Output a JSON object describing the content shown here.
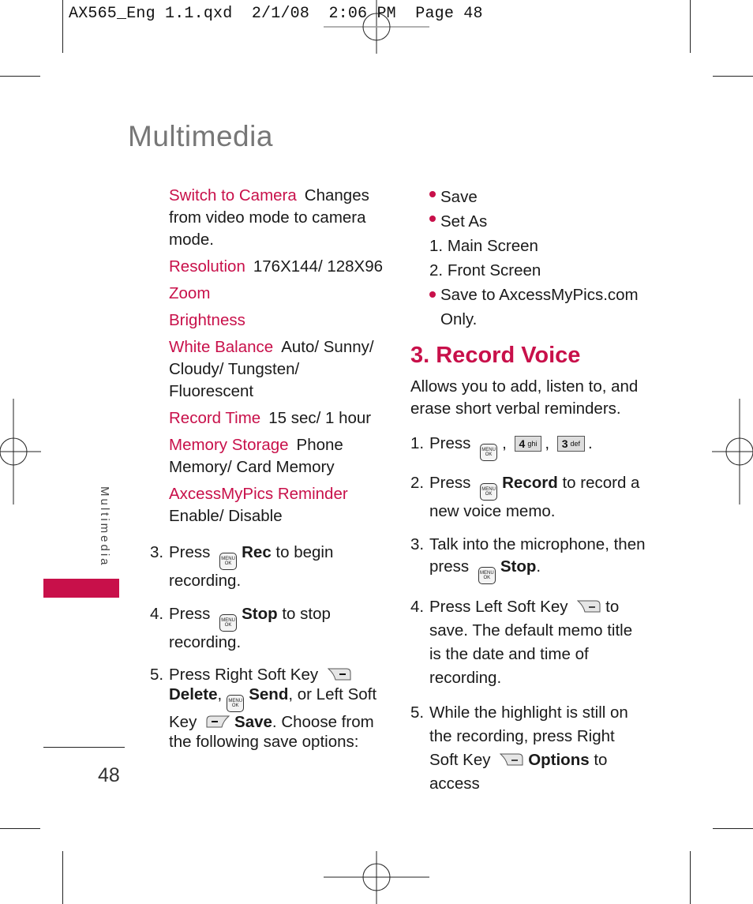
{
  "slug": "AX565_Eng 1.1.qxd  2/1/08  2:06 PM  Page 48",
  "colors": {
    "accent": "#c8104a",
    "title_gray": "#777777"
  },
  "page": {
    "title": "Multimedia",
    "side_tab_label": "Multimedia",
    "page_number": "48"
  },
  "left_column": {
    "options": [
      {
        "term": "Switch to Camera",
        "desc": "Changes from video mode to camera mode."
      },
      {
        "term": "Resolution",
        "desc": "176X144/ 128X96"
      },
      {
        "term": "Zoom",
        "desc": ""
      },
      {
        "term": "Brightness",
        "desc": ""
      },
      {
        "term": "White Balance",
        "desc": "Auto/ Sunny/ Cloudy/ Tungsten/ Fluorescent"
      },
      {
        "term": "Record Time",
        "desc": "15 sec/ 1 hour"
      },
      {
        "term": "Memory Storage",
        "desc": "Phone Memory/ Card Memory"
      },
      {
        "term": "AxcessMyPics Reminder",
        "desc": "Enable/ Disable"
      }
    ],
    "steps": [
      {
        "num": "3.",
        "pre": "Press",
        "key": "menu-ok-key",
        "bold": "Rec",
        "post": "to begin recording."
      },
      {
        "num": "4.",
        "pre": "Press",
        "key": "menu-ok-key",
        "bold": "Stop",
        "post": "to stop recording."
      },
      {
        "num": "5.",
        "pre": "Press Right Soft Key",
        "bold1": "Delete",
        "mid1": ",",
        "bold2": "Send",
        "mid2": ", or Left Soft Key",
        "bold3": "Save",
        "post": ". Choose from the following save options:"
      }
    ]
  },
  "right_column": {
    "save_options": [
      {
        "type": "bullet",
        "label": "Save"
      },
      {
        "type": "bullet",
        "label": "Set As"
      },
      {
        "type": "numbered",
        "num": "1.",
        "label": "Main Screen"
      },
      {
        "type": "numbered",
        "num": "2.",
        "label": "Front Screen"
      },
      {
        "type": "bullet",
        "label": "Save to AxcessMyPics.com Only."
      }
    ],
    "section_title": "3. Record Voice",
    "intro": "Allows you to add, listen to, and erase short verbal reminders.",
    "steps": [
      {
        "num": "1.",
        "pre": "Press",
        "key1": {
          "digit": "4",
          "letters": "ghi"
        },
        "key2": {
          "digit": "3",
          "letters": "def"
        }
      },
      {
        "num": "2.",
        "pre": "Press",
        "bold": "Record",
        "post": "to record a new voice memo."
      },
      {
        "num": "3.",
        "pre": "Talk into the microphone, then press",
        "bold": "Stop",
        "post": "."
      },
      {
        "num": "4.",
        "pre": "Press Left Soft Key",
        "post": "to save. The default memo title is the date and time of recording."
      },
      {
        "num": "5.",
        "pre": "While the highlight is still on the recording, press Right Soft Key",
        "bold": "Options",
        "post": "to access"
      }
    ],
    "key_labels": {
      "menu": "MENU",
      "ok": "OK"
    }
  }
}
